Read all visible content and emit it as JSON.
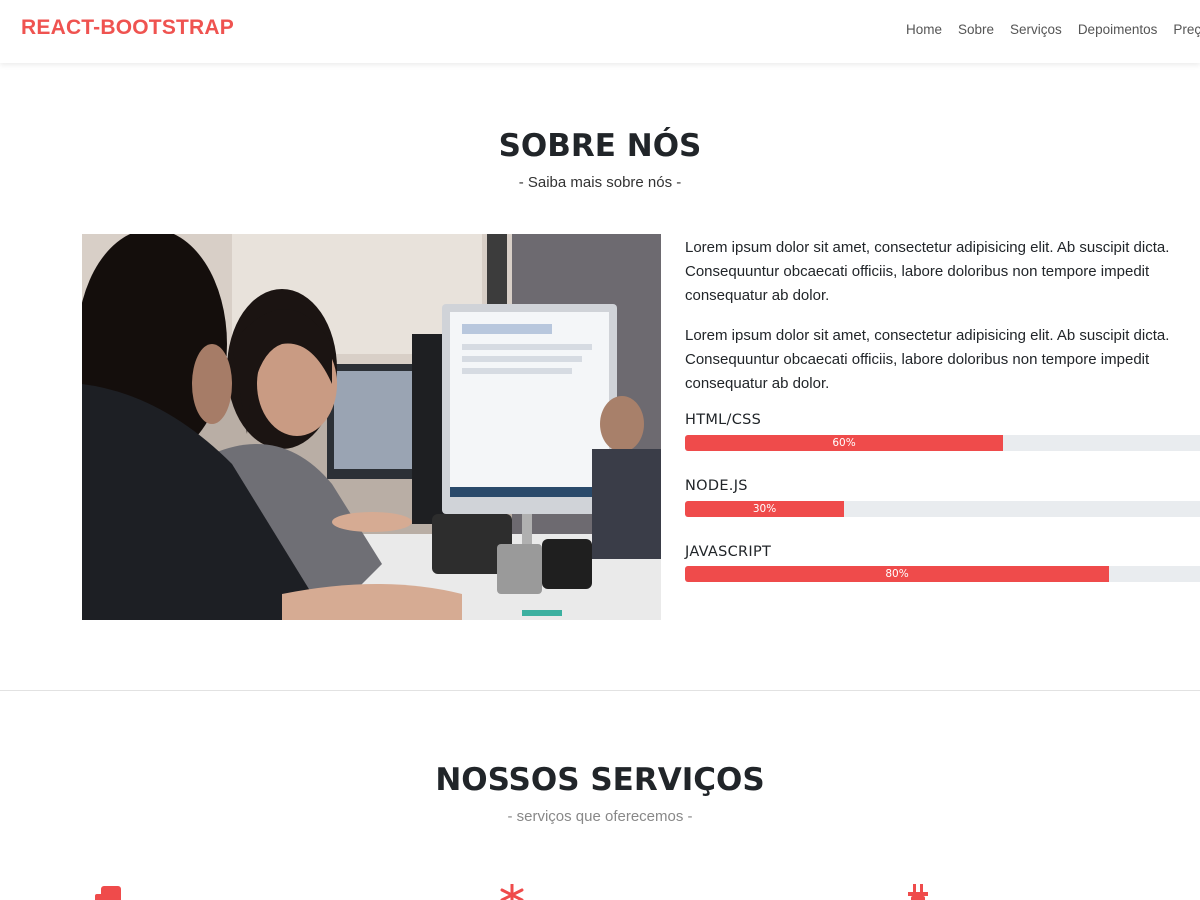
{
  "brand": "REACT-BOOTSTRAP",
  "nav": {
    "items": [
      "Home",
      "Sobre",
      "Serviços",
      "Depoimentos",
      "Preços"
    ]
  },
  "about": {
    "title": "SOBRE NÓS",
    "subtitle": "- Saiba mais sobre nós -",
    "paragraphs": [
      "Lorem ipsum dolor sit amet, consectetur adipisicing elit. Ab suscipit dicta. Consequuntur obcaecati officiis, labore doloribus non tempore impedit consequatur ab dolor.",
      "Lorem ipsum dolor sit amet, consectetur adipisicing elit. Ab suscipit dicta. Consequuntur obcaecati officiis, labore doloribus non tempore impedit consequatur ab dolor."
    ],
    "skills": [
      {
        "name": "HTML/CSS",
        "percent": 60,
        "label": "60%"
      },
      {
        "name": "NODE.JS",
        "percent": 30,
        "label": "30%"
      },
      {
        "name": "JAVASCRIPT",
        "percent": 80,
        "label": "80%"
      }
    ]
  },
  "services": {
    "title": "NOSSOS SERVIÇOS",
    "subtitle": "- serviços que oferecemos -",
    "icons": [
      "clone-icon",
      "snowflake-icon",
      "plug-icon"
    ]
  },
  "colors": {
    "accent": "#ef4b4b",
    "brand": "#ef5350",
    "bar_track": "#e9ecef"
  }
}
